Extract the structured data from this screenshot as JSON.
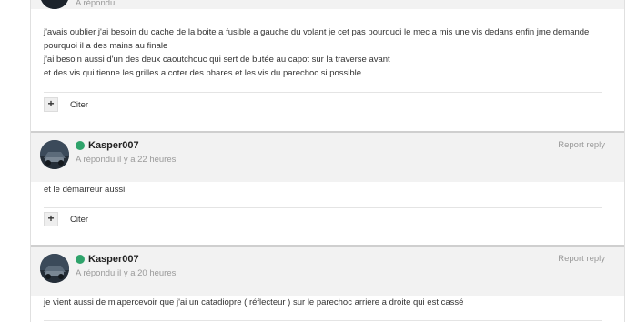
{
  "post1": {
    "time": "A répondu",
    "body_lines": [
      "j'avais oublier j'ai besoin du cache de la boite a fusible a gauche du volant je cet pas pourquoi le mec a mis une vis dedans enfin jme demande",
      "pourquoi il a des mains au finale",
      "j'ai besoin aussi d'un des deux caoutchouc qui sert de butée au capot sur la traverse avant",
      "et des vis qui tienne les grilles a coter des phares et les vis du parechoc si possible"
    ],
    "quote_icon": "+",
    "quote_label": "Citer"
  },
  "post2": {
    "author": "Kasper007",
    "time": "A répondu il y a 22 heures",
    "report": "Report reply",
    "body_lines": [
      "et le démarreur aussi"
    ],
    "quote_icon": "+",
    "quote_label": "Citer"
  },
  "post3": {
    "author": "Kasper007",
    "time": "A répondu il y a 20 heures",
    "report": "Report reply",
    "body_lines": [
      "je vient aussi de m'apercevoir que j'ai un catadiopre ( réflecteur ) sur le parechoc arriere a droite qui est cassé"
    ]
  },
  "colors": {
    "online": "#2fa36b",
    "header_bg": "#f2f2f2",
    "muted_text": "#9a9a9a"
  },
  "icons": {
    "online": "online-status-icon",
    "quote": "plus-icon",
    "avatar": "car-avatar"
  }
}
